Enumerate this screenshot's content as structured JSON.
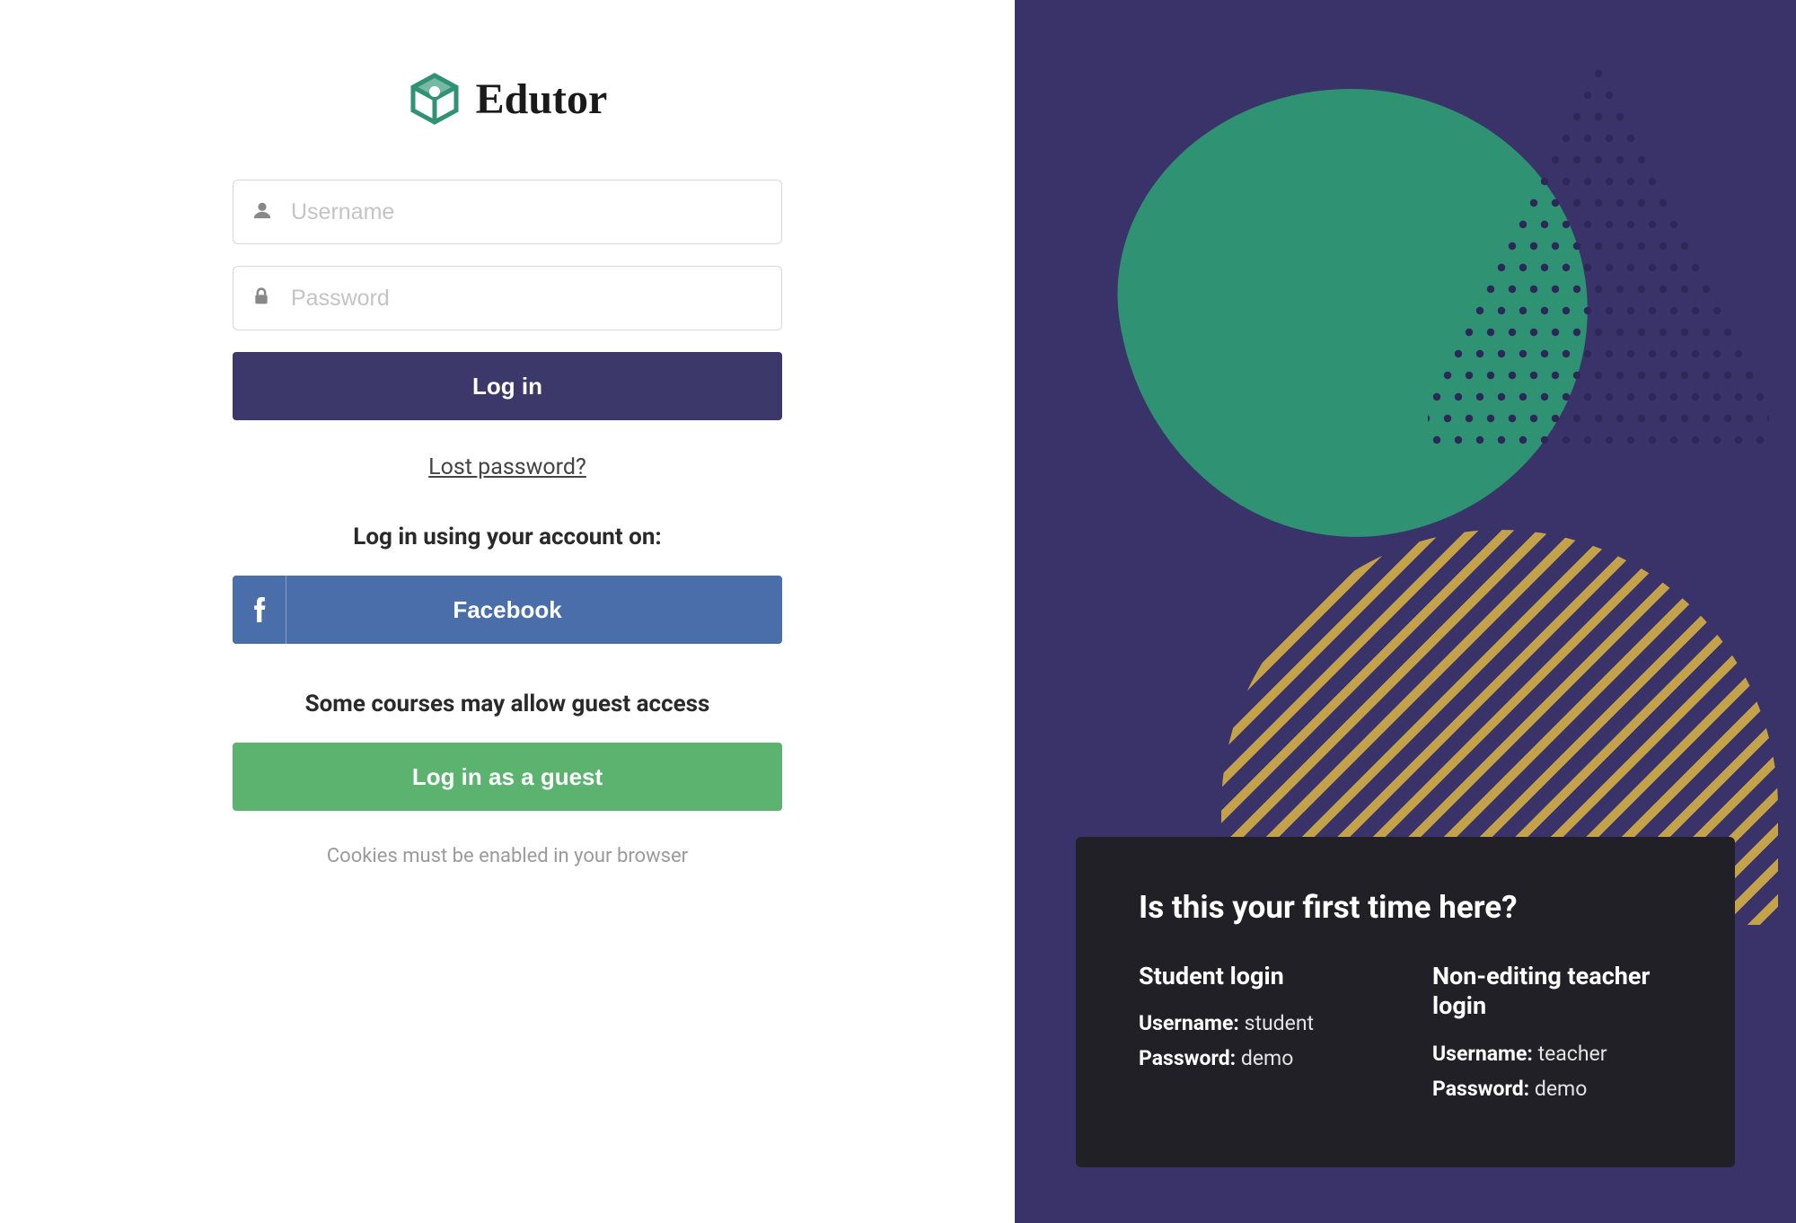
{
  "brand": {
    "name": "Edutor"
  },
  "form": {
    "username_placeholder": "Username",
    "password_placeholder": "Password",
    "login_label": "Log in",
    "lost_password": "Lost password?",
    "social_heading": "Log in using your account on:",
    "facebook_label": "Facebook",
    "guest_heading": "Some courses may allow guest access",
    "guest_label": "Log in as a guest",
    "cookie_note": "Cookies must be enabled in your browser"
  },
  "info": {
    "title": "Is this your first time here?",
    "student": {
      "heading": "Student login",
      "username_label": "Username:",
      "username_value": "student",
      "password_label": "Password:",
      "password_value": "demo"
    },
    "teacher": {
      "heading": "Non-editing teacher login",
      "username_label": "Username:",
      "username_value": "teacher",
      "password_label": "Password:",
      "password_value": "demo"
    }
  },
  "colors": {
    "primary": "#3c3869",
    "facebook": "#4a6ea9",
    "guest": "#5bb36f",
    "right_bg": "#3a3369",
    "blob": "#2e9273",
    "stripe": "#c4a24a"
  }
}
